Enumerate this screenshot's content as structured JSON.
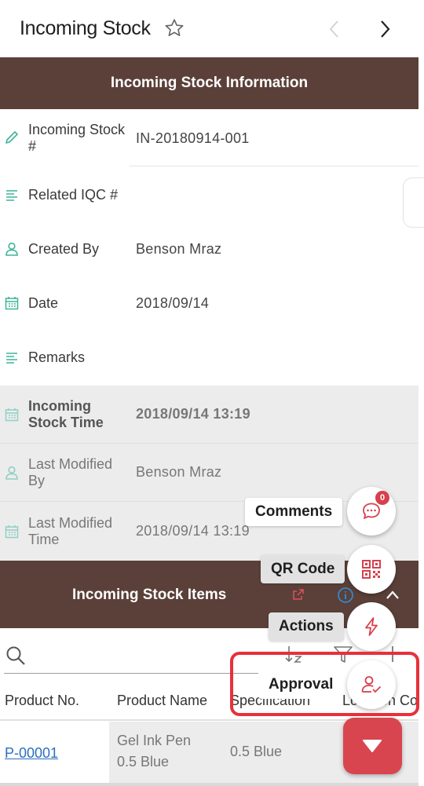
{
  "header": {
    "title": "Incoming Stock"
  },
  "info_section": {
    "title": "Incoming Stock Information",
    "fields": [
      {
        "label": "Incoming Stock #",
        "value": "IN-20180914-001",
        "icon": "pencil-icon"
      },
      {
        "label": "Related IQC #",
        "value": "",
        "icon": "lines-icon"
      },
      {
        "label": "Created By",
        "value": "Benson Mraz",
        "icon": "person-icon"
      },
      {
        "label": "Date",
        "value": "2018/09/14",
        "icon": "calendar-icon"
      },
      {
        "label": "Remarks",
        "value": "",
        "icon": "lines-icon"
      },
      {
        "label": "Incoming Stock Time",
        "value": "2018/09/14 13:19",
        "icon": "calendar-icon"
      },
      {
        "label": "Last Modified By",
        "value": "Benson Mraz",
        "icon": "person-icon"
      },
      {
        "label": "Last Modified Time",
        "value": "2018/09/14 13:19",
        "icon": "calendar-icon"
      }
    ]
  },
  "items_section": {
    "title": "Incoming Stock Items",
    "columns": [
      "Product No.",
      "Product Name",
      "Specification",
      "Location Code"
    ],
    "rows": [
      {
        "product_no": "P-00001",
        "product_name_line1": "Gel Ink Pen",
        "product_name_line2": "0.5 Blue",
        "specification": "0.5 Blue"
      }
    ]
  },
  "speed_dial": {
    "comments_label": "Comments",
    "comments_badge": "0",
    "qrcode_label": "QR Code",
    "actions_label": "Actions",
    "approval_label": "Approval"
  },
  "colors": {
    "header_brown": "#5b4039",
    "accent_red": "#d9454f",
    "teal_icon": "#3fb39b",
    "link_blue": "#2a6fbf",
    "highlight_red": "#e8303a"
  }
}
